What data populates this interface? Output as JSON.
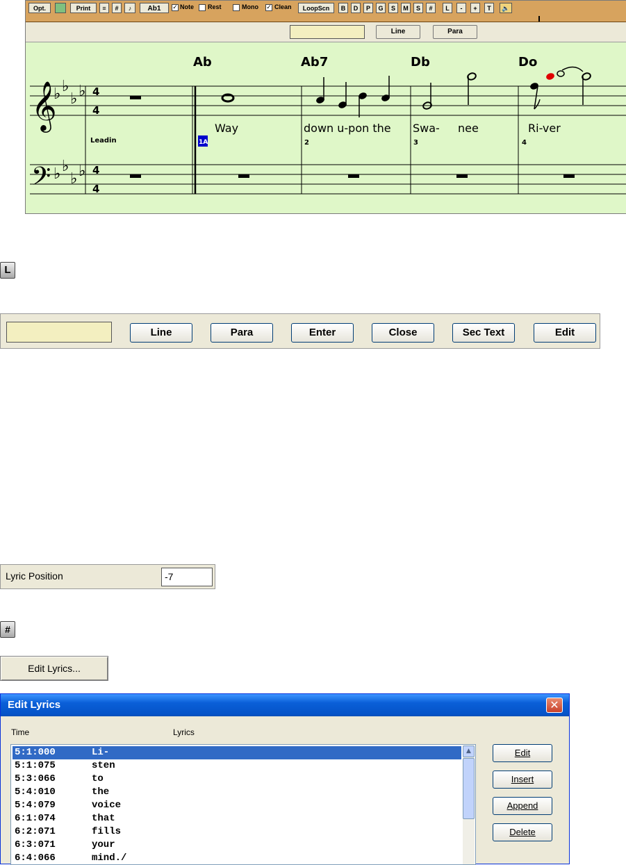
{
  "notation": {
    "toolbar": {
      "opt": "Opt.",
      "print": "Print",
      "chord_box": "Ab1",
      "note_label": "Note",
      "rest_label": "Rest",
      "mono_label": "Mono",
      "clean_label": "Clean",
      "loopscn": "LoopScn",
      "letters": [
        "B",
        "D",
        "P",
        "G",
        "S",
        "M",
        "S",
        "#"
      ],
      "l_btn": "L",
      "minus_btn": "-",
      "plus_btn": "+",
      "t_btn": "T"
    },
    "lyric_bar": {
      "line": "Line",
      "para": "Para"
    },
    "chords": [
      "Ab",
      "Ab7",
      "Db",
      "Do"
    ],
    "lyrics": [
      "Way",
      "down u-pon the",
      "Swa-",
      "nee",
      "Ri-ver"
    ],
    "leadin": "Leadin",
    "bar_marker": "1A",
    "bar_numbers": [
      "2",
      "3",
      "4"
    ],
    "time_sig_top": "4",
    "time_sig_bottom": "4"
  },
  "l_icon": {
    "label": "L"
  },
  "lyric_bar_large": {
    "buttons": [
      "Line",
      "Para",
      "Enter",
      "Close",
      "Sec Text",
      "Edit"
    ]
  },
  "lyric_position": {
    "label": "Lyric Position",
    "value": "-7"
  },
  "hash_icon": {
    "label": "#"
  },
  "edit_lyrics_button": {
    "label": "Edit Lyrics..."
  },
  "edit_lyrics_dialog": {
    "title": "Edit Lyrics",
    "close": "✕",
    "columns": {
      "time": "Time",
      "lyrics": "Lyrics"
    },
    "rows": [
      {
        "time": "5:1:000",
        "lyric": "Li-"
      },
      {
        "time": "5:1:075",
        "lyric": "sten"
      },
      {
        "time": "5:3:066",
        "lyric": "to"
      },
      {
        "time": "5:4:010",
        "lyric": "the"
      },
      {
        "time": "5:4:079",
        "lyric": "voice"
      },
      {
        "time": "6:1:074",
        "lyric": "that"
      },
      {
        "time": "6:2:071",
        "lyric": "fills"
      },
      {
        "time": "6:3:071",
        "lyric": "your"
      },
      {
        "time": "6:4:066",
        "lyric": "mind./"
      }
    ],
    "buttons": {
      "edit": "Edit",
      "insert": "Insert",
      "append": "Append",
      "delete": "Delete"
    }
  }
}
